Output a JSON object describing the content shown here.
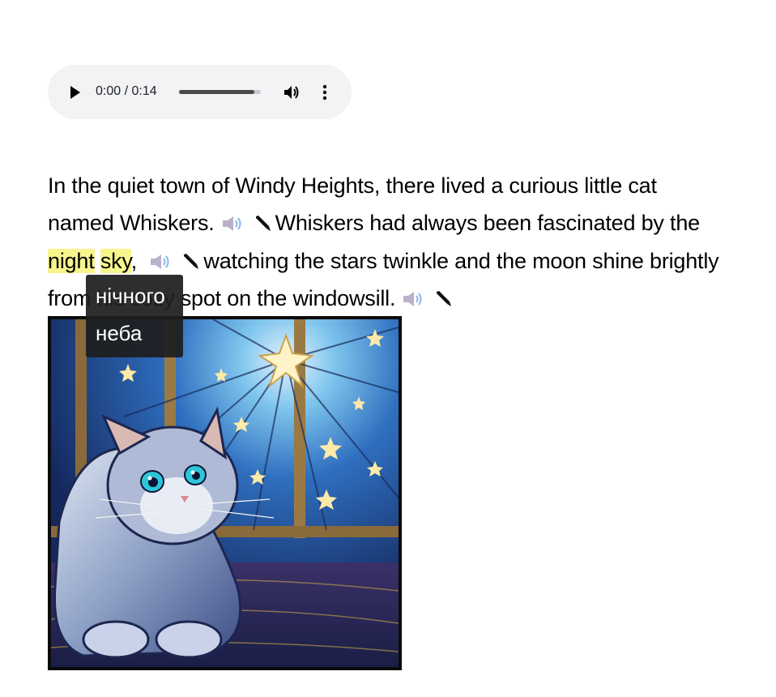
{
  "audio": {
    "time_display": "0:00 / 0:14",
    "progress_fraction": 0.92
  },
  "story": {
    "s1": "In the quiet town of Windy Heights, there lived a curious little cat named Whiskers.",
    "s2_before": "Whiskers had always been fascinated by the",
    "word_night": "night",
    "word_sky": "sky",
    "s2_after": ", ",
    "s3": "watching the stars twinkle and the moon shine brightly from his cozy spot on the windowsill."
  },
  "tooltip": {
    "line1": "нічного",
    "line2": "неба"
  },
  "colors": {
    "highlight": "#f7f58c",
    "player_bg": "#f1f3f4",
    "tooltip_bg": "#1e1e1e"
  },
  "icons": [
    "play-icon",
    "volume-icon",
    "more-vert-icon",
    "speaker-icon",
    "pencil-icon"
  ]
}
